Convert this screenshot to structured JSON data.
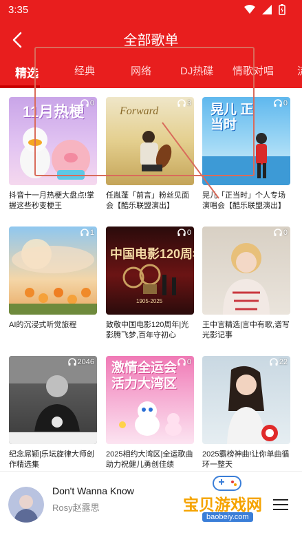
{
  "status_bar": {
    "time": "3:35"
  },
  "header": {
    "title": "全部歌单"
  },
  "tabs": [
    {
      "label": "精选",
      "active": true
    },
    {
      "label": "经典"
    },
    {
      "label": "网络"
    },
    {
      "label": "DJ热碟"
    },
    {
      "label": "情歌对唱"
    },
    {
      "label": "流"
    }
  ],
  "playlists": [
    {
      "title": "抖音十一月热梗大盘点!掌握这些秒变梗王",
      "plays": "0",
      "cover_text": "11月热梗"
    },
    {
      "title": "任胤蓬「前言」粉丝见面会【酷乐联盟演出】",
      "plays": "3",
      "cover_text": "Forward"
    },
    {
      "title": "晃儿「正当时」个人专场演唱会【酷乐联盟演出】",
      "plays": "0",
      "cover_text": "晃儿 正当时"
    },
    {
      "title": "AI的沉浸式听觉旅程",
      "plays": "1",
      "cover_text": ""
    },
    {
      "title": "致敬中国电影120周年|光影腾飞梦,百年守初心",
      "plays": "0",
      "cover_text": "中国电影120周年",
      "cover_subtext": "1905-2025"
    },
    {
      "title": "王中言精选|言中有歌,谱写光影记事",
      "plays": "0",
      "cover_text": ""
    },
    {
      "title": "纪念屌颖|乐坛旋律大师创作精选集",
      "plays": "2046",
      "cover_text": ""
    },
    {
      "title": "2025相约大湾区|全运歌曲助力祝健儿勇创佳绩",
      "plays": "0",
      "cover_text": "激情全运会 活力大湾区"
    },
    {
      "title": "2025霸榜神曲!让你单曲循环一整天",
      "plays": "22",
      "cover_text": ""
    }
  ],
  "player": {
    "title": "Don't Wanna Know",
    "artist": "Rosy赵露思"
  },
  "watermark": {
    "text": "宝贝游戏网",
    "url": "baobeiy.com"
  },
  "colors": {
    "brand_red": "#e81e1e",
    "tab_underline": "#c80000"
  }
}
